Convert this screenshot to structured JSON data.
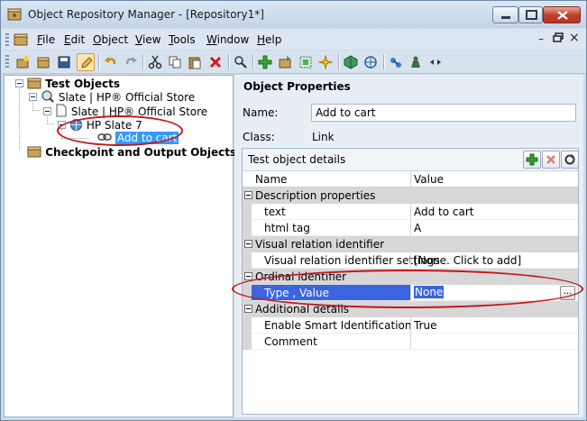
{
  "window": {
    "title": "Object Repository Manager - [Repository1*]"
  },
  "menu": {
    "items": [
      {
        "label": "File",
        "accel": "F"
      },
      {
        "label": "Edit",
        "accel": "E"
      },
      {
        "label": "Object",
        "accel": "O"
      },
      {
        "label": "View",
        "accel": "V"
      },
      {
        "label": "Tools",
        "accel": "T"
      },
      {
        "label": "Window",
        "accel": "W"
      },
      {
        "label": "Help",
        "accel": "H"
      }
    ],
    "mdi_minimize": "–",
    "mdi_restore": "🗗",
    "mdi_close": "×"
  },
  "toolbar": {
    "icons": [
      "new-repository-icon",
      "open-icon",
      "save-icon",
      "edit-pencil-icon",
      "undo-icon",
      "redo-icon",
      "cut-icon",
      "copy-icon",
      "paste-icon",
      "delete-icon",
      "find-icon",
      "add-object-icon",
      "update-from-app-icon",
      "highlight-icon",
      "locate-icon",
      "checkpoint-icon",
      "object-spy-icon",
      "connect-icon",
      "associate-icon",
      "more-icon"
    ]
  },
  "tree": {
    "root_label": "Test Objects",
    "browser_label": "Slate | HP® Official Store",
    "page_label": "Slate | HP® Official Store",
    "frame_label": "HP Slate 7",
    "link_label": "Add to cart",
    "checkpoint_label": "Checkpoint and Output Objects"
  },
  "properties": {
    "heading": "Object Properties",
    "name_label": "Name:",
    "name_value": "Add to cart",
    "class_label": "Class:",
    "class_value": "Link",
    "details_heading": "Test object details",
    "columns": {
      "name": "Name",
      "value": "Value"
    },
    "rows": [
      {
        "type": "category",
        "name": "Description properties"
      },
      {
        "type": "prop",
        "name": "text",
        "value": "Add to cart"
      },
      {
        "type": "prop",
        "name": "html tag",
        "value": "A"
      },
      {
        "type": "category",
        "name": "Visual relation identifier"
      },
      {
        "type": "prop",
        "name": "Visual relation identifier settings",
        "value": "[None. Click to add]"
      },
      {
        "type": "category",
        "name": "Ordinal identifier"
      },
      {
        "type": "prop",
        "name": "Type , Value",
        "value": "None",
        "selected": true
      },
      {
        "type": "category",
        "name": "Additional details"
      },
      {
        "type": "prop",
        "name": "Enable Smart Identification",
        "value": "True"
      },
      {
        "type": "prop",
        "name": "Comment",
        "value": ""
      }
    ],
    "ellipsis_label": "..."
  },
  "colors": {
    "selection": "#3399ff",
    "grid_selection": "#3b64e0",
    "annotation": "#c4161c"
  }
}
